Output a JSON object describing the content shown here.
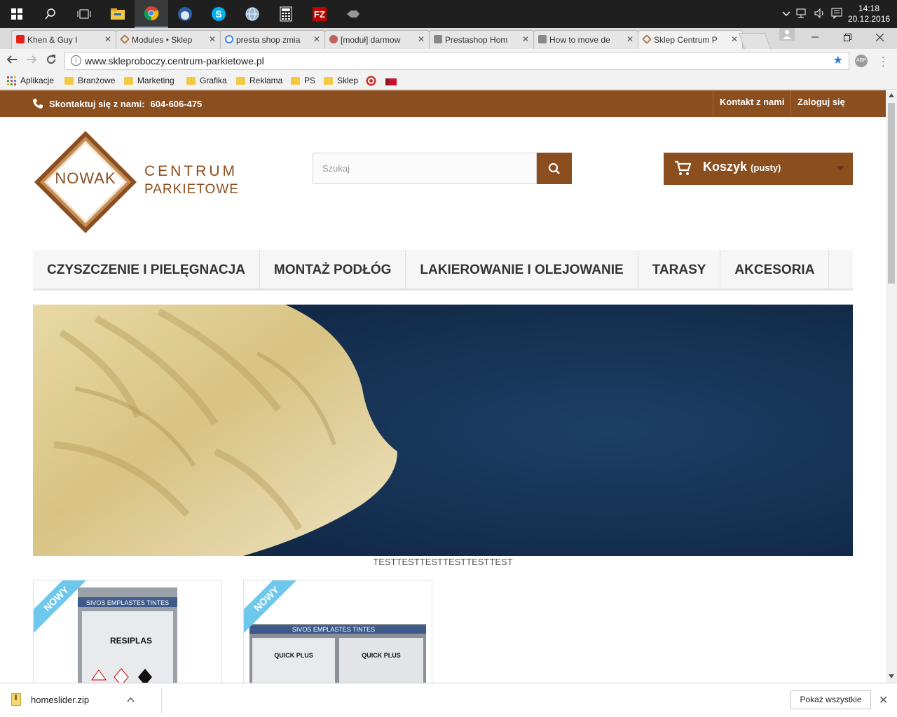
{
  "taskbar": {
    "time": "14:18",
    "date": "20.12.2016"
  },
  "browser": {
    "tabs": [
      {
        "title": "Khen & Guy I",
        "favicon_color": "#e62117"
      },
      {
        "title": "Modules • Sklep",
        "favicon_color": "#b07a4a"
      },
      {
        "title": "presta shop zmia",
        "favicon_color": "#4285f4"
      },
      {
        "title": "[moduł] darmow",
        "favicon_color": "#c06060"
      },
      {
        "title": "Prestashop Hom",
        "favicon_color": "#666666"
      },
      {
        "title": "How to move de",
        "favicon_color": "#666666"
      },
      {
        "title": "Sklep Centrum P",
        "favicon_color": "#b07a4a"
      }
    ],
    "url": "www.skleproboczy.centrum-parkietowe.pl",
    "bookmarks": [
      "Aplikacje",
      "Branżowe",
      "Marketing",
      "Grafika",
      "Reklama",
      "PS",
      "Sklep"
    ],
    "download": {
      "filename": "homeslider.zip",
      "show_all": "Pokaż wszystkie"
    }
  },
  "site": {
    "contact_prefix": "Skontaktuj się z nami:",
    "phone": "604-606-475",
    "top_links": [
      "Kontakt z nami",
      "Zaloguj się"
    ],
    "logo": {
      "mark": "NOWAK",
      "line1": "CENTRUM",
      "line2": "PARKIETOWE"
    },
    "search_placeholder": "Szukaj",
    "cart": {
      "label": "Koszyk",
      "status": "(pusty)"
    },
    "menu": [
      "CZYSZCZENIE I PIELĘGNACJA",
      "MONTAŻ PODŁÓG",
      "LAKIEROWANIE I OLEJOWANIE",
      "TARASY",
      "AKCESORIA"
    ],
    "slider_caption": "TESTTESTTESTTESTTESTTEST",
    "products": [
      {
        "badge": "NOWY",
        "label": "RESIPLAS"
      },
      {
        "badge": "NOWY",
        "label": "QUICK PLUS"
      }
    ],
    "colors": {
      "brand_brown": "#8b4e1f",
      "ribbon_blue": "#6ec8ee"
    }
  }
}
